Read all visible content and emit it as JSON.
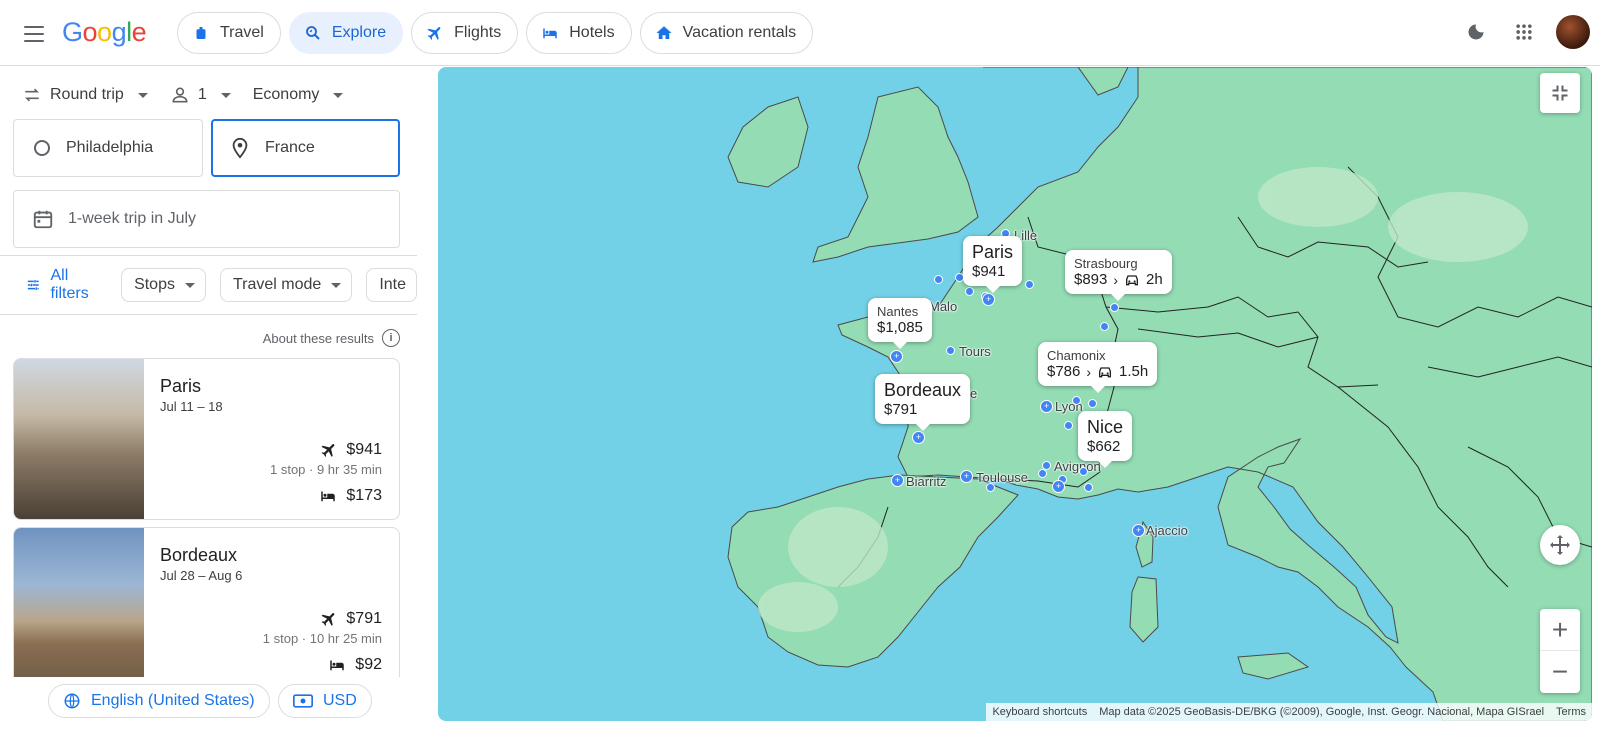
{
  "header": {
    "logo": "Google",
    "nav": [
      {
        "label": "Travel",
        "icon": "travel-icon"
      },
      {
        "label": "Explore",
        "icon": "explore-icon",
        "active": true
      },
      {
        "label": "Flights",
        "icon": "flights-icon"
      },
      {
        "label": "Hotels",
        "icon": "hotels-icon"
      },
      {
        "label": "Vacation rentals",
        "icon": "vacation-rentals-icon"
      }
    ]
  },
  "search": {
    "trip_type": "Round trip",
    "passengers": "1",
    "cabin": "Economy",
    "origin": "Philadelphia",
    "destination": "France",
    "dates": "1-week trip in July"
  },
  "filters": {
    "all_filters": "All filters",
    "chips": [
      "Stops",
      "Travel mode",
      "Inte"
    ]
  },
  "about": "About these results",
  "results": [
    {
      "city": "Paris",
      "dates": "Jul 11 – 18",
      "flight_price": "$941",
      "flight_meta": "1 stop · 9 hr 35 min",
      "hotel_price": "$173"
    },
    {
      "city": "Bordeaux",
      "dates": "Jul 28 – Aug 6",
      "flight_price": "$791",
      "flight_meta": "1 stop · 10 hr 25 min",
      "hotel_price": "$92"
    }
  ],
  "footer": {
    "language": "English (United States)",
    "currency": "USD"
  },
  "map": {
    "labels": {
      "lille": "Lille",
      "malo": "Malo",
      "tours": "Tours",
      "elle": "elle",
      "lyon": "Lyon",
      "avignon": "Avignon",
      "toulouse": "Toulouse",
      "biarritz": "Biarritz",
      "ajaccio": "Ajaccio"
    },
    "pins": {
      "paris": {
        "name": "Paris",
        "price": "$941"
      },
      "strasbourg": {
        "name": "Strasbourg",
        "price": "$893",
        "drive": "2h"
      },
      "nantes": {
        "name": "Nantes",
        "price": "$1,085"
      },
      "chamonix": {
        "name": "Chamonix",
        "price": "$786",
        "drive": "1.5h"
      },
      "bordeaux": {
        "name": "Bordeaux",
        "price": "$791"
      },
      "nice": {
        "name": "Nice",
        "price": "$662"
      }
    },
    "attribution": {
      "shortcuts": "Keyboard shortcuts",
      "data": "Map data ©2025 GeoBasis-DE/BKG (©2009), Google, Inst. Geogr. Nacional, Mapa GISrael",
      "terms": "Terms"
    },
    "colors": {
      "water": "#72d1e6",
      "land": "#93dcb4",
      "border": "#1f1f1f",
      "accent": "#1a73e8",
      "dot": "#4285f4"
    }
  }
}
